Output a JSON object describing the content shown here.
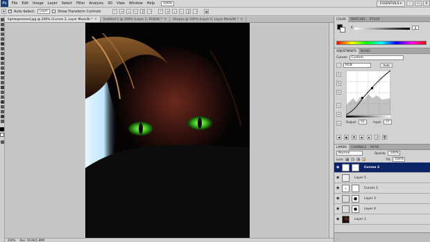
{
  "app": {
    "logo": "Ps"
  },
  "menu": [
    "File",
    "Edit",
    "Image",
    "Layer",
    "Select",
    "Filter",
    "Analysis",
    "3D",
    "View",
    "Window",
    "Help"
  ],
  "menu_zoom": "100%",
  "workspace": "ESSENTIALS ▾",
  "options": {
    "auto_select_label": "Auto-Select:",
    "auto_select_value": "Layer",
    "transform_label": "Show Transform Controls"
  },
  "tabs": [
    {
      "label": "liqmeapressed.jpg @ 200% (Curves 2, Layer Mask/8) *",
      "active": true
    },
    {
      "label": "Untitled-1 @ 100% (Layer 1, RGB/8) *",
      "active": false
    },
    {
      "label": "Shapes @ 100% (Layer 0, Layer Mask/8) *",
      "active": false
    }
  ],
  "status": {
    "zoom": "200%",
    "doc": "Doc: 39.4K/1.89M"
  },
  "color_panel": {
    "tabs": [
      "COLOR",
      "SWATCHES",
      "STYLES"
    ],
    "channel": "K",
    "value": "0"
  },
  "adjustments_panel": {
    "tabs": [
      "ADJUSTMENTS",
      "MASKS"
    ],
    "title": "Curves",
    "preset": "Custom",
    "channel": "RGB",
    "auto_label": "Auto",
    "output_label": "Output:",
    "output_value": "61",
    "input_label": "Input:",
    "input_value": "37"
  },
  "layers_panel": {
    "tabs": [
      "LAYERS",
      "CHANNELS",
      "PATHS"
    ],
    "blend_mode": "Normal",
    "opacity_label": "Opacity:",
    "opacity_value": "100%",
    "lock_label": "Lock:",
    "fill_label": "Fill:",
    "fill_value": "100%",
    "layers": [
      {
        "name": "Curves 2",
        "selected": true
      },
      {
        "name": "Layer 5",
        "selected": false
      },
      {
        "name": "Curves 1",
        "selected": false
      },
      {
        "name": "Layer 3",
        "selected": false
      },
      {
        "name": "Layer 4",
        "selected": false
      },
      {
        "name": "Layer 1",
        "selected": false
      }
    ]
  },
  "colors": {
    "accent_selected": "#0b2468",
    "eye_glow": "#3fbf1f"
  }
}
